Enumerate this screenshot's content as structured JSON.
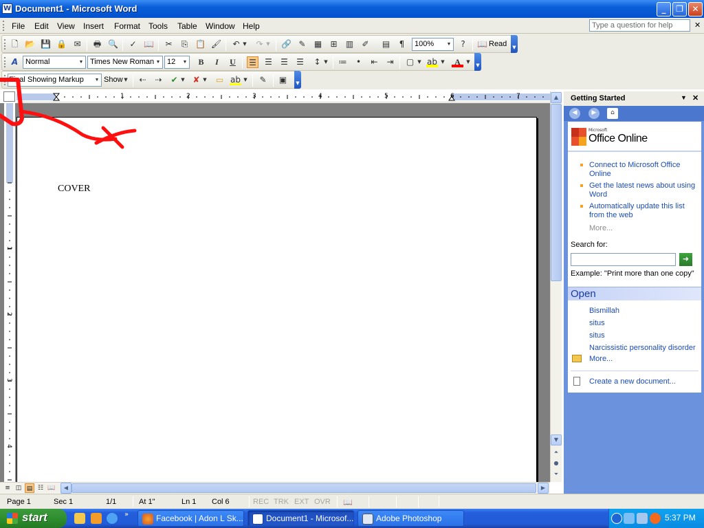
{
  "window": {
    "title": "Document1 - Microsoft Word",
    "app_icon": "W"
  },
  "menu": {
    "items": [
      "File",
      "Edit",
      "View",
      "Insert",
      "Format",
      "Tools",
      "Table",
      "Window",
      "Help"
    ],
    "help_placeholder": "Type a question for help"
  },
  "standard_toolbar": {
    "zoom": "100%",
    "read_label": "Read"
  },
  "formatting_toolbar": {
    "style": "Normal",
    "font": "Times New Roman",
    "size": "12",
    "font_color": "#ff0000",
    "highlight_color": "#ffff00"
  },
  "reviewing_toolbar": {
    "markup": "Final Showing Markup",
    "show_label": "Show"
  },
  "ruler": {
    "h_numbers": [
      "1",
      "2",
      "3",
      "4",
      "5",
      "6",
      "7"
    ],
    "v_numbers": [
      "1",
      "2",
      "3",
      "4"
    ]
  },
  "document": {
    "text": "COVER"
  },
  "task_pane": {
    "title": "Getting Started",
    "logo_small": "Microsoft",
    "logo_big": "Office Online",
    "links": [
      "Connect to Microsoft Office Online",
      "Get the latest news about using Word",
      "Automatically update this list from the web"
    ],
    "more": "More...",
    "search_label": "Search for:",
    "search_value": "",
    "example": "Example:  \"Print more than one copy\"",
    "open_heading": "Open",
    "recent_files": [
      "Bismillah",
      "situs",
      "situs",
      "Narcissistic personality disorder"
    ],
    "open_more": "More...",
    "create_new": "Create a new document..."
  },
  "status_bar": {
    "page": "Page  1",
    "sec": "Sec  1",
    "pages": "1/1",
    "at": "At  1\"",
    "ln": "Ln  1",
    "col": "Col  6",
    "rec": "REC",
    "trk": "TRK",
    "ext": "EXT",
    "ovr": "OVR"
  },
  "taskbar": {
    "start": "start",
    "items": [
      "Facebook | Adon L Sk...",
      "Document1 - Microsof...",
      "Adobe Photoshop"
    ],
    "clock": "5:37 PM"
  }
}
